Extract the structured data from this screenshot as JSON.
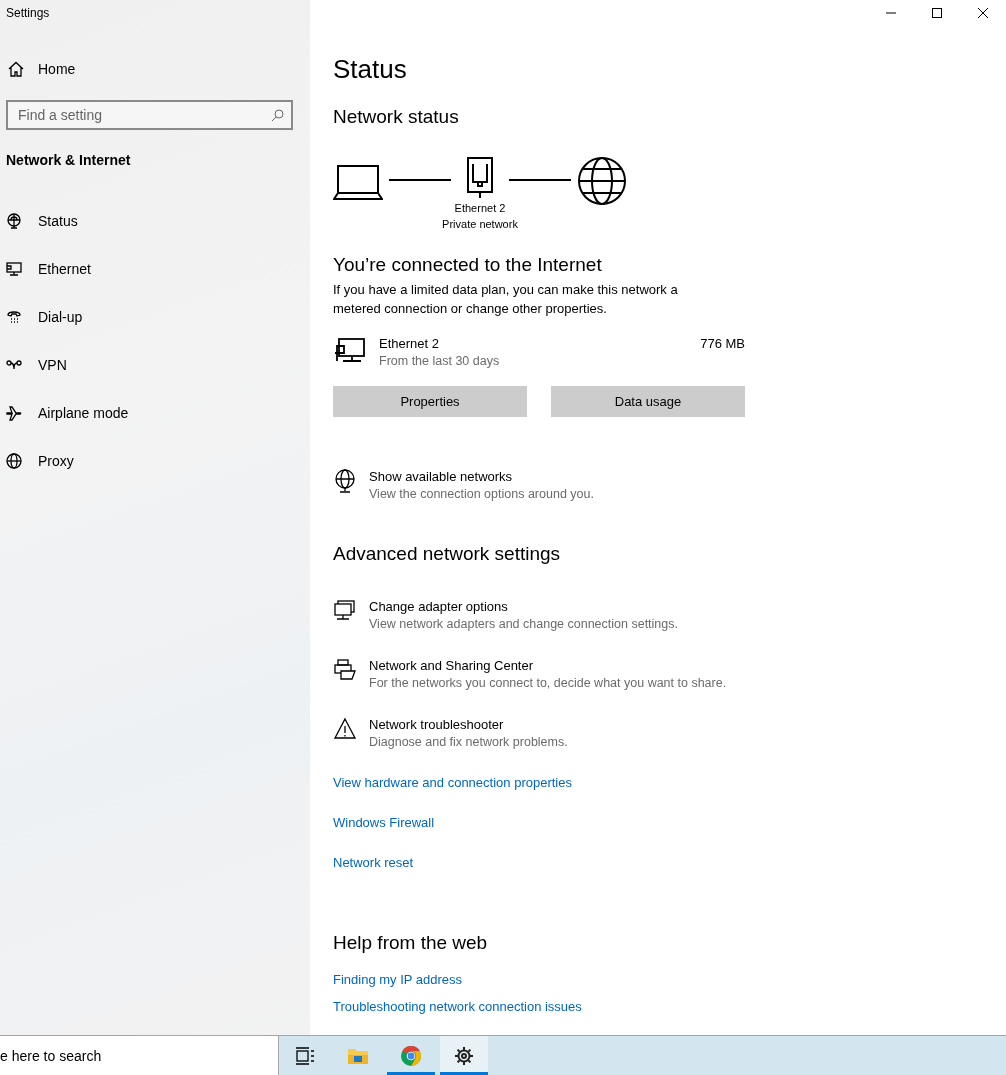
{
  "window": {
    "title": "Settings"
  },
  "sidebar": {
    "home": "Home",
    "search": {
      "placeholder": "Find a setting"
    },
    "section": "Network & Internet",
    "items": [
      {
        "kind": "status",
        "label": "Status"
      },
      {
        "kind": "ethernet",
        "label": "Ethernet"
      },
      {
        "kind": "dialup",
        "label": "Dial-up"
      },
      {
        "kind": "vpn",
        "label": "VPN"
      },
      {
        "kind": "airplane",
        "label": "Airplane mode"
      },
      {
        "kind": "proxy",
        "label": "Proxy"
      }
    ]
  },
  "content": {
    "title": "Status",
    "network_status": {
      "heading": "Network status",
      "adapter_name": "Ethernet 2",
      "network_type": "Private network"
    },
    "connection": {
      "heading": "You’re connected to the Internet",
      "description": "If you have a limited data plan, you can make this network a metered connection or change other properties.",
      "adapter": {
        "name": "Ethernet 2",
        "period": "From the last 30 days",
        "usage": "776 MB"
      },
      "buttons": [
        "Properties",
        "Data usage"
      ]
    },
    "show_networks": {
      "title": "Show available networks",
      "description": "View the connection options around you."
    },
    "advanced": {
      "heading": "Advanced network settings",
      "items": [
        {
          "kind": "adapter",
          "title": "Change adapter options",
          "description": "View network adapters and change connection settings."
        },
        {
          "kind": "sharing",
          "title": "Network and Sharing Center",
          "description": "For the networks you connect to, decide what you want to share."
        },
        {
          "kind": "troubleshoot",
          "title": "Network troubleshooter",
          "description": "Diagnose and fix network problems."
        }
      ],
      "links": [
        "View hardware and connection properties",
        "Windows Firewall",
        "Network reset"
      ]
    },
    "help": {
      "heading": "Help from the web",
      "links": [
        "Finding my IP address",
        "Troubleshooting network connection issues"
      ]
    }
  },
  "taskbar": {
    "search": "e here to search",
    "apps": [
      {
        "kind": "taskview",
        "running": false,
        "selected": false
      },
      {
        "kind": "explorer",
        "running": false,
        "selected": false
      },
      {
        "kind": "chrome",
        "running": true,
        "selected": false
      },
      {
        "kind": "settings",
        "running": true,
        "selected": true
      }
    ]
  }
}
